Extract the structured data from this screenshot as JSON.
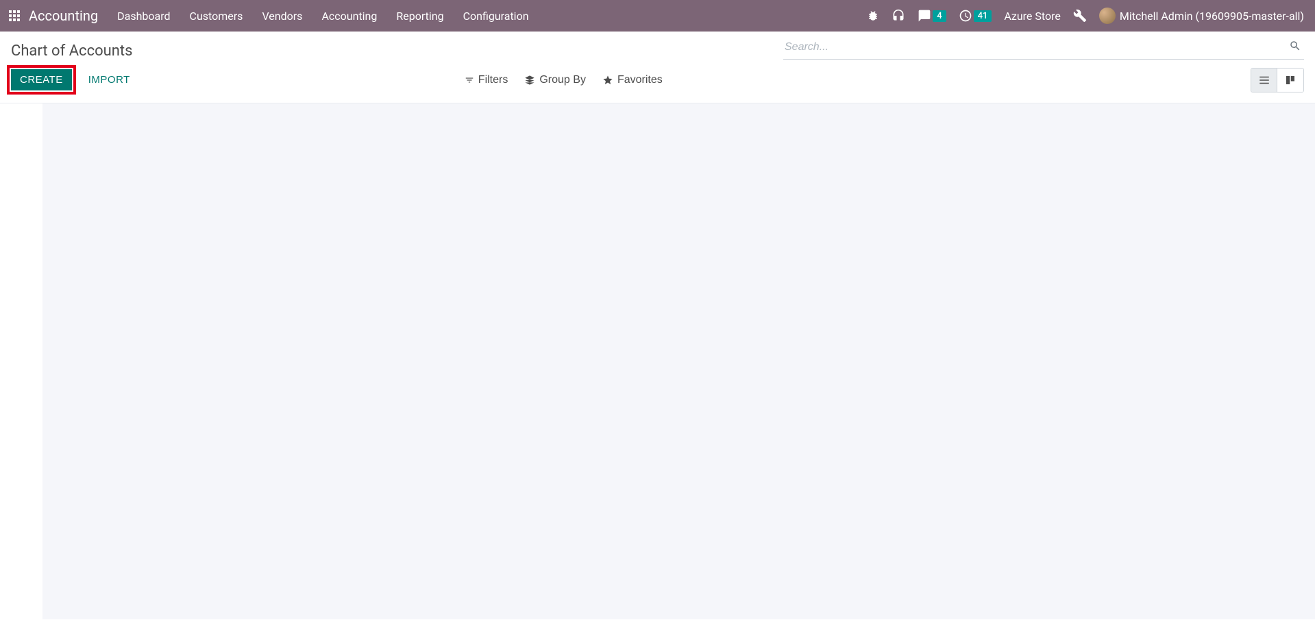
{
  "topnav": {
    "brand": "Accounting",
    "menu": [
      "Dashboard",
      "Customers",
      "Vendors",
      "Accounting",
      "Reporting",
      "Configuration"
    ],
    "store": "Azure Store",
    "user": "Mitchell Admin (19609905-master-all)",
    "messages_badge": "4",
    "activities_badge": "41"
  },
  "page": {
    "title": "Chart of Accounts"
  },
  "search": {
    "placeholder": "Search..."
  },
  "buttons": {
    "create": "CREATE",
    "import": "IMPORT"
  },
  "toolbar": {
    "filters": "Filters",
    "group_by": "Group By",
    "favorites": "Favorites"
  }
}
